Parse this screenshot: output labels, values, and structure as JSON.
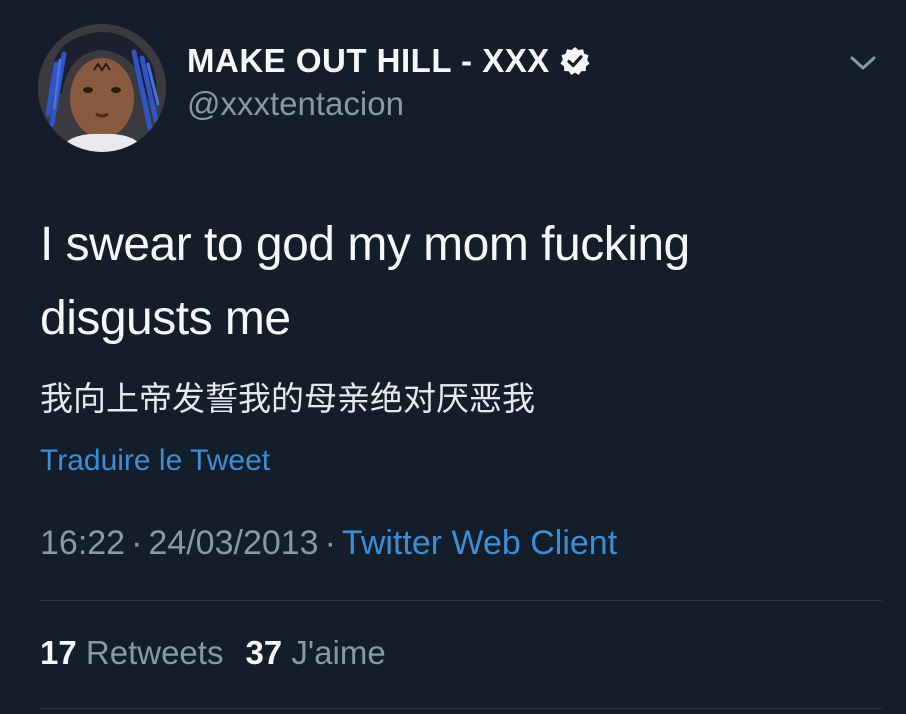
{
  "tweet": {
    "display_name": "MAKE OUT HILL - XXX",
    "handle": "@xxxtentacion",
    "text": "I swear to god my mom fucking disgusts me",
    "translated_text": "我向上帝发誓我的母亲绝对厌恶我",
    "translate_link": "Traduire le Tweet",
    "time": "16:22",
    "date": "24/03/2013",
    "separator": "·",
    "client": "Twitter Web Client",
    "retweets_count": "17",
    "retweets_label": "Retweets",
    "likes_count": "37",
    "likes_label": "J'aime"
  },
  "icons": {
    "verified": "verified-badge-icon",
    "menu": "chevron-down-icon",
    "avatar": "profile-avatar"
  },
  "colors": {
    "background": "#141d2a",
    "link": "#3a8fd6",
    "secondary_text": "#8899a6",
    "primary_text": "#f5f7f9"
  }
}
